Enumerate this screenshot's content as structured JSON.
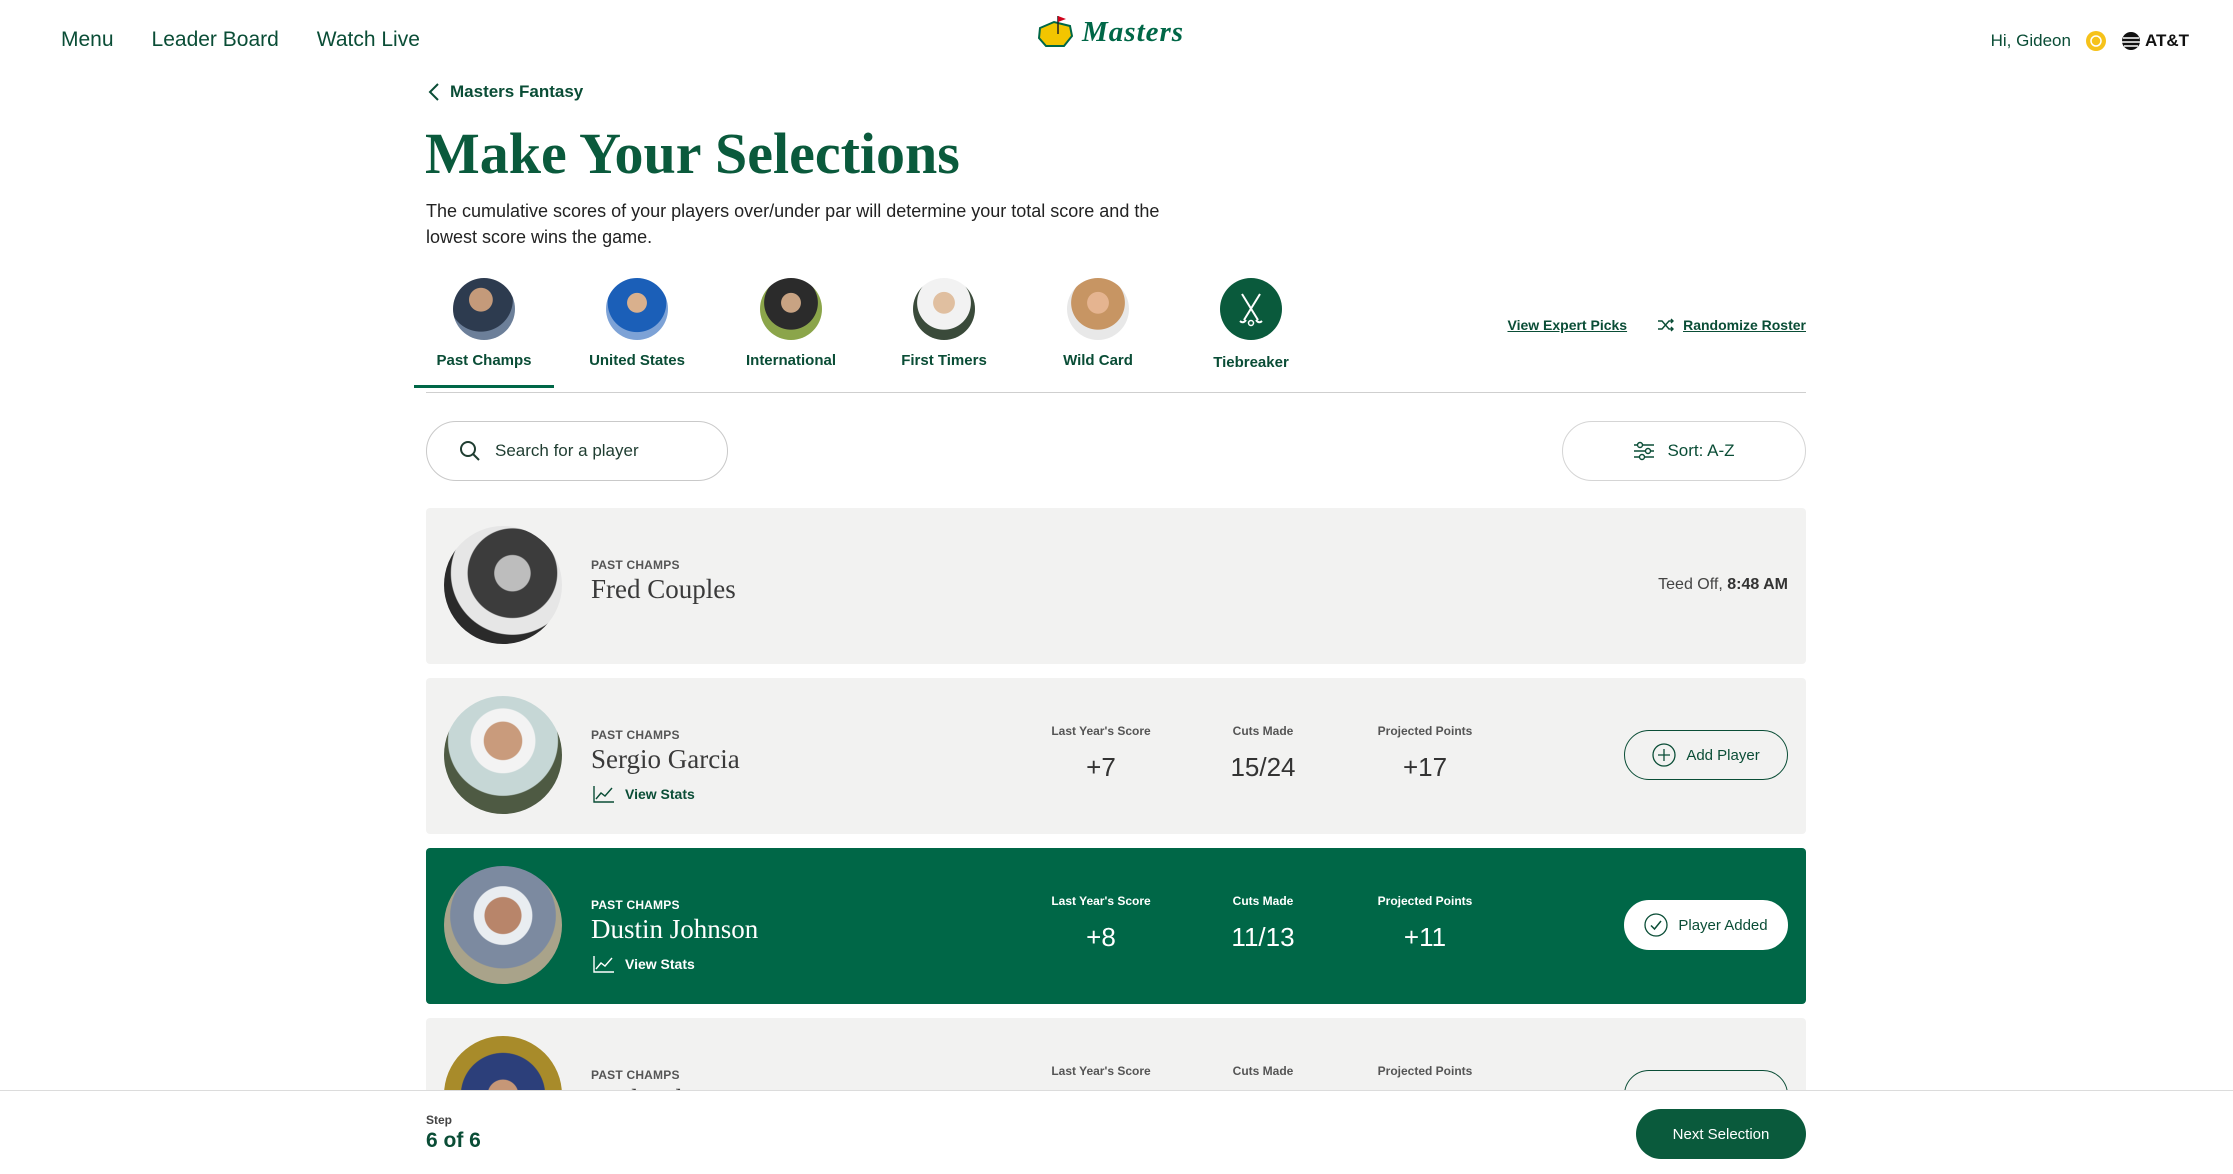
{
  "nav": {
    "left": [
      "Menu",
      "Leader Board",
      "Watch Live"
    ],
    "brand": "Masters",
    "greeting": "Hi, Gideon",
    "sponsor": "AT&T"
  },
  "header": {
    "back_label": "Masters Fantasy",
    "title": "Make Your Selections",
    "intro": "The cumulative scores of your players over/under par will determine your total score and the lowest score wins the game."
  },
  "categories": [
    {
      "label": "Past Champs",
      "active": true
    },
    {
      "label": "United States"
    },
    {
      "label": "International"
    },
    {
      "label": "First Timers"
    },
    {
      "label": "Wild Card"
    },
    {
      "label": "Tiebreaker"
    }
  ],
  "category_actions": {
    "expert": "View Expert Picks",
    "randomize": "Randomize Roster"
  },
  "search": {
    "placeholder": "Search for a player"
  },
  "sort": {
    "label": "Sort: A-Z"
  },
  "stat_labels": {
    "last": "Last Year's Score",
    "cuts": "Cuts Made",
    "proj": "Projected Points"
  },
  "players": [
    {
      "category": "PAST CHAMPS",
      "name": "Fred Couples",
      "teed_prefix": "Teed Off,",
      "teed_time": "8:48 AM"
    },
    {
      "category": "PAST CHAMPS",
      "name": "Sergio Garcia",
      "stats_link": "View Stats",
      "last": "+7",
      "cuts": "15/24",
      "proj": "+17",
      "button": "Add Player"
    },
    {
      "category": "PAST CHAMPS",
      "name": "Dustin Johnson",
      "stats_link": "View Stats",
      "last": "+8",
      "cuts": "11/13",
      "proj": "+11",
      "button": "Player Added",
      "selected": true
    },
    {
      "category": "PAST CHAMPS",
      "name": "Zach Johnson"
    }
  ],
  "footer": {
    "step_label": "Step",
    "step_value": "6 of 6",
    "next": "Next Selection"
  },
  "colors": {
    "brand_green": "#006747",
    "card_bg": "#f2f2f1"
  }
}
